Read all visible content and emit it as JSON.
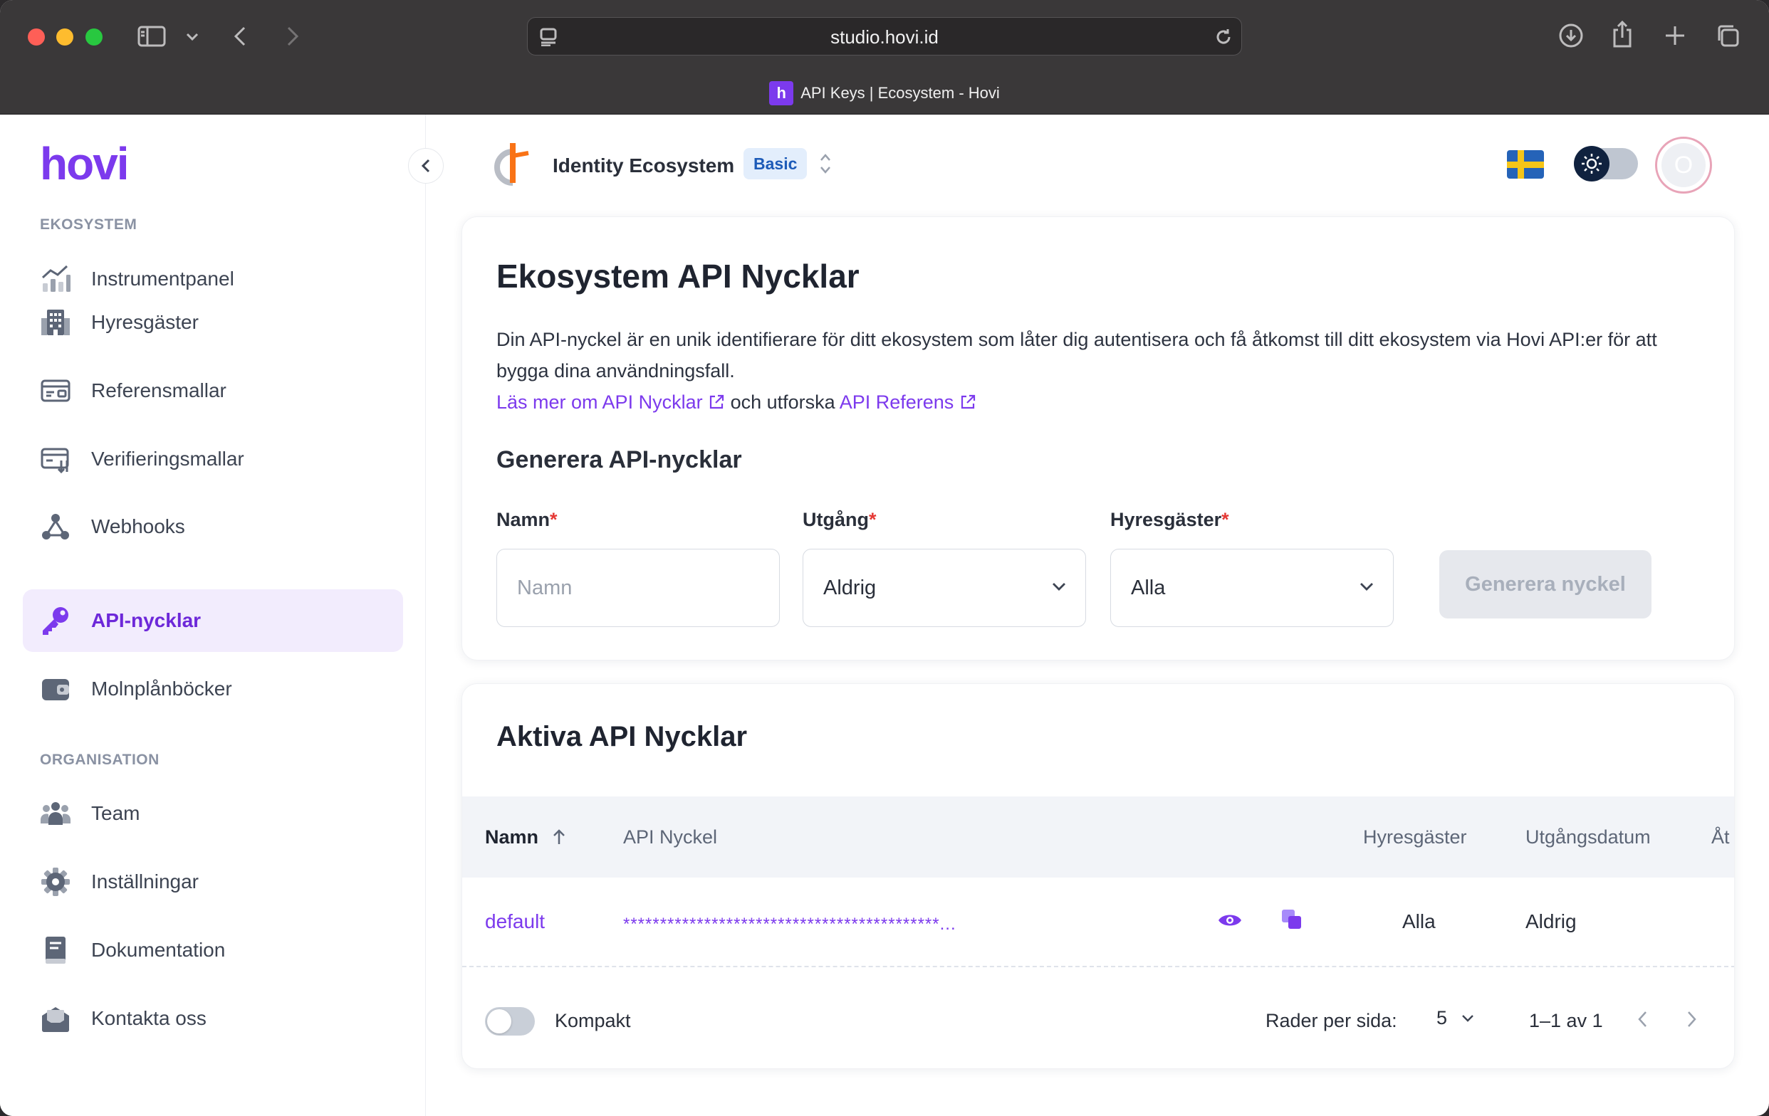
{
  "browser": {
    "url": "studio.hovi.id",
    "tab_title": "API Keys | Ecosystem - Hovi",
    "favicon_letter": "h"
  },
  "sidebar": {
    "logo": "hovi",
    "sections": [
      {
        "label": "EKOSYSTEM",
        "items": [
          {
            "label": "Instrumentpanel",
            "icon": "chart-icon"
          },
          {
            "label": "Hyresgäster",
            "icon": "building-icon"
          },
          {
            "label": "Referensmallar",
            "icon": "id-card-icon"
          },
          {
            "label": "Verifieringsmallar",
            "icon": "verify-card-icon"
          },
          {
            "label": "Webhooks",
            "icon": "webhook-icon"
          },
          {
            "label": "API-nycklar",
            "icon": "key-icon",
            "active": true
          },
          {
            "label": "Molnplånböcker",
            "icon": "wallet-icon"
          }
        ]
      },
      {
        "label": "ORGANISATION",
        "items": [
          {
            "label": "Team",
            "icon": "team-icon"
          },
          {
            "label": "Inställningar",
            "icon": "gear-icon"
          },
          {
            "label": "Dokumentation",
            "icon": "book-icon"
          },
          {
            "label": "Kontakta oss",
            "icon": "mail-icon"
          }
        ]
      }
    ]
  },
  "topbar": {
    "ecosystem_name": "Identity Ecosystem",
    "plan": "Basic",
    "avatar_initial": "O",
    "language_flag": "sweden-flag-icon"
  },
  "keys_card": {
    "title": "Ekosystem API Nycklar",
    "description": "Din API-nyckel är en unik identifierare för ditt ekosystem som låter dig autentisera och få åtkomst till ditt ekosystem via Hovi API:er för att bygga dina användningsfall.",
    "link_learn": "Läs mer om API Nycklar",
    "link_middle": "och utforska",
    "link_reference": "API Referens",
    "generate_title": "Generera API-nycklar",
    "fields": {
      "name_label": "Namn",
      "name_placeholder": "Namn",
      "expiry_label": "Utgång",
      "expiry_value": "Aldrig",
      "tenants_label": "Hyresgäster",
      "tenants_value": "Alla",
      "required_mark": "*"
    },
    "generate_button": "Generera nyckel"
  },
  "active_card": {
    "title": "Aktiva API Nycklar",
    "columns": [
      "Namn",
      "API Nyckel",
      "Hyresgäster",
      "Utgångsdatum",
      "Åt"
    ],
    "rows": [
      {
        "name": "default",
        "key": "*******************************************...",
        "tenants": "Alla",
        "expiry": "Aldrig"
      }
    ],
    "footer": {
      "compact_label": "Kompakt",
      "rows_per_page_label": "Rader per sida:",
      "rows_per_page_value": "5",
      "range": "1–1 av 1"
    }
  },
  "colors": {
    "accent": "#7c3aed",
    "active_bg": "#f2ecfd",
    "required": "#e53935"
  }
}
